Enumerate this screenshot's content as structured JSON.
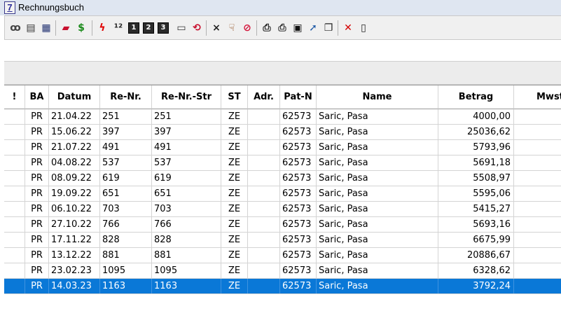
{
  "window": {
    "title": "Rechnungsbuch",
    "icon_label": "7"
  },
  "toolbar": {
    "buttons": [
      {
        "name": "glasses-icon",
        "glyph": "ꝏ",
        "color": "#444444"
      },
      {
        "name": "report-preview-icon",
        "glyph": "▤",
        "color": "#333333"
      },
      {
        "name": "table-view-icon",
        "glyph": "▦",
        "color": "#1f2f6f"
      },
      {
        "name": "invoice-stamp-icon",
        "glyph": "▰",
        "color": "#c8102e"
      },
      {
        "name": "dollar-icon",
        "glyph": "$",
        "color": "#1a8a1a"
      },
      {
        "name": "lightning-icon",
        "glyph": "ϟ",
        "color": "#e00000"
      },
      {
        "name": "numbering-icon",
        "glyph": "¹²",
        "color": "#222222"
      },
      {
        "name": "key-1-icon",
        "glyph": "1",
        "color": "#ffffff"
      },
      {
        "name": "key-2-icon",
        "glyph": "2",
        "color": "#ffffff"
      },
      {
        "name": "key-3-icon",
        "glyph": "3",
        "color": "#ffffff"
      },
      {
        "name": "number-format-icon",
        "glyph": "▭",
        "color": "#333333"
      },
      {
        "name": "refresh-arrows-icon",
        "glyph": "⟲",
        "color": "#c8102e"
      },
      {
        "name": "close-x-icon",
        "glyph": "×",
        "color": "#222222"
      },
      {
        "name": "thumb-down-icon",
        "glyph": "☟",
        "color": "#8b4513"
      },
      {
        "name": "cancel-circle-icon",
        "glyph": "⊘",
        "color": "#d4143a"
      },
      {
        "name": "printer-icon",
        "glyph": "⎙",
        "color": "#222222"
      },
      {
        "name": "printer-setup-icon",
        "glyph": "⎙",
        "color": "#333333"
      },
      {
        "name": "save-disk-icon",
        "glyph": "▣",
        "color": "#111111"
      },
      {
        "name": "export-icon",
        "glyph": "➚",
        "color": "#1f5aa6"
      },
      {
        "name": "copy-window-icon",
        "glyph": "❐",
        "color": "#222222"
      },
      {
        "name": "delete-icon",
        "glyph": "✕",
        "color": "#d40000"
      },
      {
        "name": "exit-door-icon",
        "glyph": "▯",
        "color": "#222222"
      }
    ]
  },
  "table": {
    "columns": [
      "!",
      "BA",
      "Datum",
      "Re-Nr.",
      "Re-Nr.-Str",
      "ST",
      "Adr.",
      "Pat-N",
      "Name",
      "Betrag",
      "Mwst"
    ],
    "rows": [
      [
        "",
        "PR",
        "21.04.22",
        "251",
        "251",
        "ZE",
        "",
        "62573",
        "Saric, Pasa",
        "4000,00",
        ""
      ],
      [
        "",
        "PR",
        "15.06.22",
        "397",
        "397",
        "ZE",
        "",
        "62573",
        "Saric, Pasa",
        "25036,62",
        ""
      ],
      [
        "",
        "PR",
        "21.07.22",
        "491",
        "491",
        "ZE",
        "",
        "62573",
        "Saric, Pasa",
        "5793,96",
        ""
      ],
      [
        "",
        "PR",
        "04.08.22",
        "537",
        "537",
        "ZE",
        "",
        "62573",
        "Saric, Pasa",
        "5691,18",
        ""
      ],
      [
        "",
        "PR",
        "08.09.22",
        "619",
        "619",
        "ZE",
        "",
        "62573",
        "Saric, Pasa",
        "5508,97",
        ""
      ],
      [
        "",
        "PR",
        "19.09.22",
        "651",
        "651",
        "ZE",
        "",
        "62573",
        "Saric, Pasa",
        "5595,06",
        ""
      ],
      [
        "",
        "PR",
        "06.10.22",
        "703",
        "703",
        "ZE",
        "",
        "62573",
        "Saric, Pasa",
        "5415,27",
        ""
      ],
      [
        "",
        "PR",
        "27.10.22",
        "766",
        "766",
        "ZE",
        "",
        "62573",
        "Saric, Pasa",
        "5693,16",
        ""
      ],
      [
        "",
        "PR",
        "17.11.22",
        "828",
        "828",
        "ZE",
        "",
        "62573",
        "Saric, Pasa",
        "6675,99",
        ""
      ],
      [
        "",
        "PR",
        "13.12.22",
        "881",
        "881",
        "ZE",
        "",
        "62573",
        "Saric, Pasa",
        "20886,67",
        ""
      ],
      [
        "",
        "PR",
        "23.02.23",
        "1095",
        "1095",
        "ZE",
        "",
        "62573",
        "Saric, Pasa",
        "6328,62",
        ""
      ],
      [
        "",
        "PR",
        "14.03.23",
        "1163",
        "1163",
        "ZE",
        "",
        "62573",
        "Saric, Pasa",
        "3792,24",
        ""
      ]
    ],
    "selected_row": 11,
    "selection_color": "#0a78d7"
  }
}
